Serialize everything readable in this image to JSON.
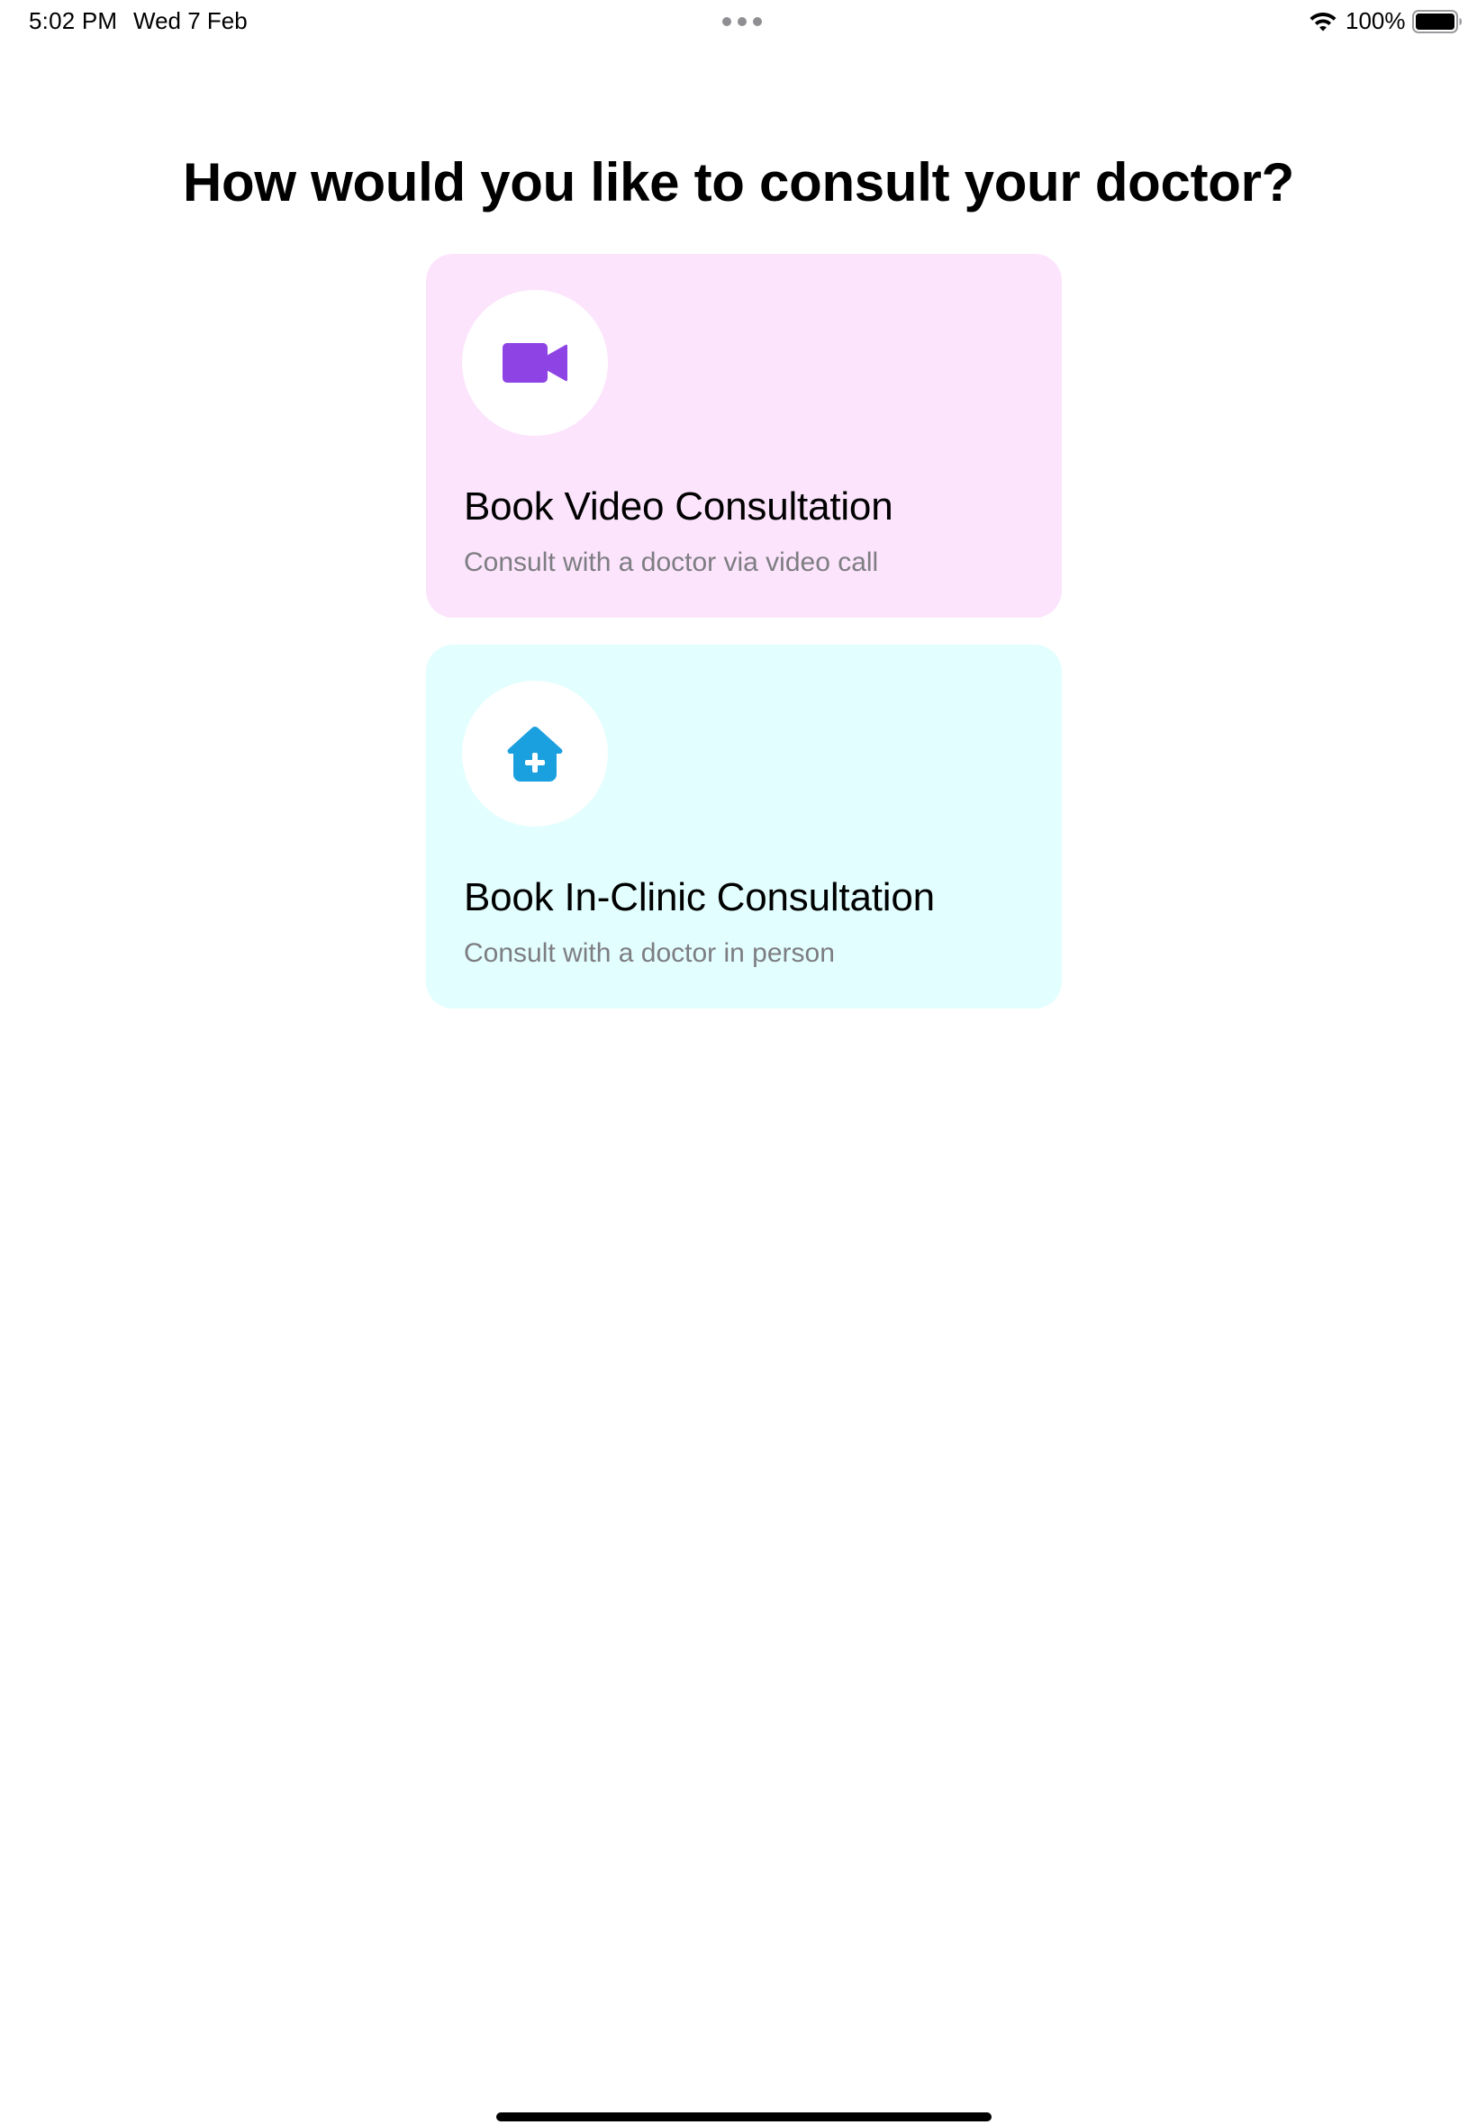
{
  "status_bar": {
    "time": "5:02 PM",
    "date": "Wed 7 Feb",
    "battery_percent": "100%",
    "battery_level": 1.0,
    "icons": [
      "multitask-dots",
      "wifi-icon",
      "battery-icon"
    ]
  },
  "page": {
    "title": "How would you like to consult your doctor?"
  },
  "options": [
    {
      "title": "Book Video Consultation",
      "subtitle": "Consult with a doctor via video call",
      "icon": "video-camera-icon",
      "background": "#fce4fc",
      "icon_color": "#8e44e4"
    },
    {
      "title": "Book In-Clinic Consultation",
      "subtitle": "Consult with a doctor in person",
      "icon": "clinic-house-icon",
      "background": "#e2fefe",
      "icon_color": "#1a9fdf"
    }
  ]
}
